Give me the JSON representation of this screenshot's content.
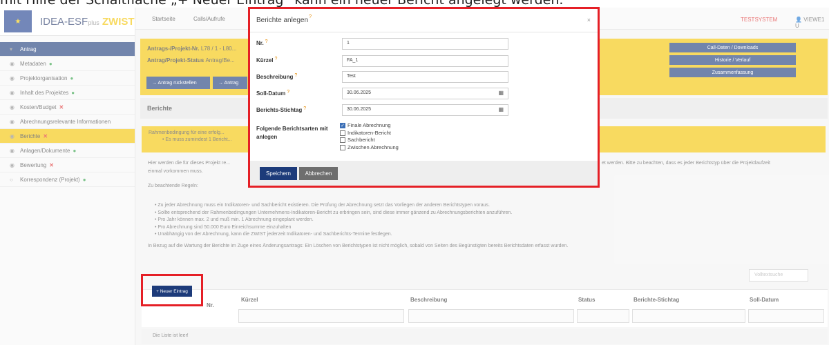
{
  "caption": "mit Hilfe der Schaltfläche „+ Neuer Eintrag“ kann ein neuer Bericht angelegt werden.",
  "app": {
    "logo": "IDEA-ESF",
    "logo_plus": "plus",
    "logo_zwist": "ZWIST",
    "topnav": [
      "Startseite",
      "Calls/Aufrufe"
    ],
    "system_label": "TESTSYSTEM",
    "user_label": "VIEWE1 U"
  },
  "sidebar": {
    "items": [
      {
        "label": "Antrag",
        "status": ""
      },
      {
        "label": "Metadaten",
        "status": "ok"
      },
      {
        "label": "Projektorganisation",
        "status": "ok"
      },
      {
        "label": "Inhalt des Projektes",
        "status": "ok"
      },
      {
        "label": "Kosten/Budget",
        "status": "err"
      },
      {
        "label": "Abrechnungsrelevante Informationen",
        "status": ""
      },
      {
        "label": "Berichte",
        "status": "err"
      },
      {
        "label": "Anlagen/Dokumente",
        "status": "ok"
      },
      {
        "label": "Bewertung",
        "status": "err"
      },
      {
        "label": "Korrespondenz (Projekt)",
        "status": "ok"
      }
    ]
  },
  "project_box": {
    "line1": "Antrags-/Projekt-Nr.",
    "line1_value": "L78 / 1 - L80...",
    "line2": "Antrag/Projekt-Status",
    "line2_value": "Antrag/Be...",
    "btn1": "→ Antrag rückstellen",
    "btn2": "→ Antrag",
    "right_buttons": [
      "Call-Daten / Downloads",
      "Historie / Verlauf",
      "Zusammenfassung"
    ]
  },
  "section_title": "Berichte",
  "warning": {
    "line1": "Rahmenbedingung für eine erfolg...",
    "line2": "• Es muss zumindest 1 Bericht..."
  },
  "body": {
    "intro_left": "Hier werden die für dieses Projekt re...",
    "intro_right": "et werden. Bitte zu beachten, dass es jeder Berichtstyp über die Projektlaufzeit",
    "intro_line2": "einmal vorkommen muss.",
    "rules_title": "Zu beachtende Regeln:",
    "rules": [
      "• Zu jeder Abrechnung muss ein Indikatoren- und Sachbericht existieren. Die Prüfung der Abrechnung setzt das Vorliegen der anderen Berichtstypen voraus.",
      "• Sollte entsprechend der Rahmenbedingungen Unternehmens-Indikatoren-Bericht zu erbringen sein, sind diese immer gänzend zu Abrechnungsberichten anzuführen.",
      "• Pro Jahr können max. 2 und muß min. 1 Abrechnung eingeplant werden.",
      "• Pro Abrechnung sind 50.000 Euro Einreichsumme einzuhalten",
      "• Unabhängig von der Abrechnung, kann die ZWIST jederzeit Indikatoren- und Sachberichts-Termine festlegen."
    ],
    "footer_note": "In Bezug auf die Wartung der Berichte im Zuge eines Änderungsantrags: Ein Löschen von Berichtstypen ist nicht möglich, sobald von Seiten des Begünstigten bereits Berichtsdaten erfasst wurden."
  },
  "search_placeholder": "Volltextsuche",
  "table": {
    "new_entry": "+ Neuer Eintrag",
    "columns": [
      "Nr.",
      "Kürzel",
      "Beschreibung",
      "Status",
      "Berichte-Stichtag",
      "Soll-Datum"
    ],
    "empty": "Die Liste ist leer!"
  },
  "modal": {
    "title": "Berichte anlegen",
    "fields": [
      {
        "label": "Nr.",
        "value": "1"
      },
      {
        "label": "Kürzel",
        "value": "FA_1"
      },
      {
        "label": "Beschreibung",
        "value": "Test"
      },
      {
        "label": "Soll-Datum",
        "value": "30.06.2025"
      },
      {
        "label": "Berichts-Stichtag",
        "value": "30.06.2025"
      }
    ],
    "types_label_1": "Folgende Berichtsarten mit",
    "types_label_2": "anlegen",
    "types": [
      {
        "label": "Finale Abrechnung",
        "checked": true
      },
      {
        "label": "Indikatoren-Bericht",
        "checked": false
      },
      {
        "label": "Sachbericht",
        "checked": false
      },
      {
        "label": "Zwischen Abrechnung",
        "checked": false
      }
    ],
    "save": "Speichern",
    "cancel": "Abbrechen"
  },
  "colors": {
    "primary": "#1d3b7a",
    "accent": "#f5c400",
    "highlight": "#e51f26"
  }
}
